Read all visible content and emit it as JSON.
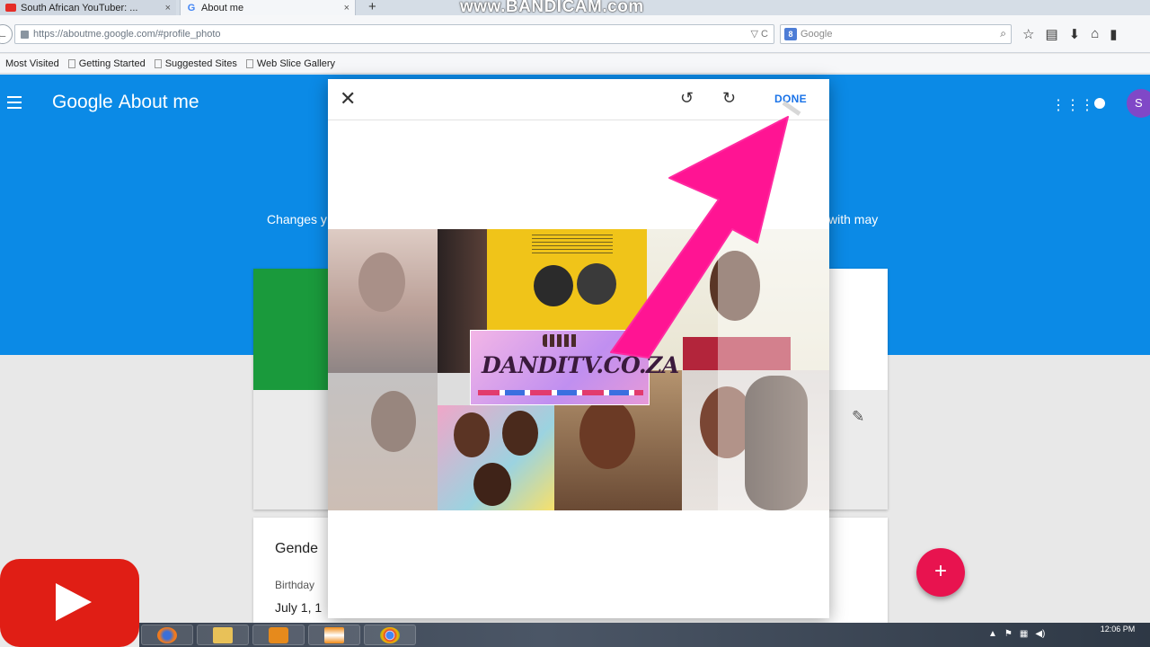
{
  "browser": {
    "tabs": [
      {
        "label": "South African YouTuber: ...",
        "close": "×"
      },
      {
        "label": "About me",
        "close": "×"
      }
    ],
    "new_tab": "+",
    "watermark": "www.BANDICAM.com",
    "url": "https://aboutme.google.com/#profile_photo",
    "url_controls": "▽ C",
    "search_placeholder": "Google",
    "search_engine_badge": "8",
    "bookmarks": [
      "Most Visited",
      "Getting Started",
      "Suggested Sites",
      "Web Slice Gallery"
    ]
  },
  "page": {
    "app_title_google": "Google",
    "app_title_about": "About me",
    "avatar_letter": "S",
    "changes_left": "Changes y",
    "changes_right": "with may",
    "gender_label": "Gende",
    "birthday_label": "Birthday",
    "birthday_value": "July 1, 1",
    "fab_label": "+"
  },
  "dialog": {
    "close_icon": "✕",
    "rotate_left_icon": "↺",
    "rotate_right_icon": "↻",
    "done_label": "DONE",
    "banner_title": "DANDITV.CO.ZA"
  },
  "taskbar": {
    "clock_time": "12:06 PM"
  },
  "colors": {
    "google_blue": "#0b8ae6",
    "fab_pink": "#e8134f",
    "arrow_pink": "#ff1493",
    "youtube_red": "#e01e15",
    "green_panel": "#1a9a3c"
  },
  "icons": {
    "menu": "hamburger-icon",
    "apps": "apps-grid-icon",
    "notifications": "notifications-icon",
    "edit": "pencil-icon",
    "lock": "lock-icon",
    "search": "search-icon"
  }
}
